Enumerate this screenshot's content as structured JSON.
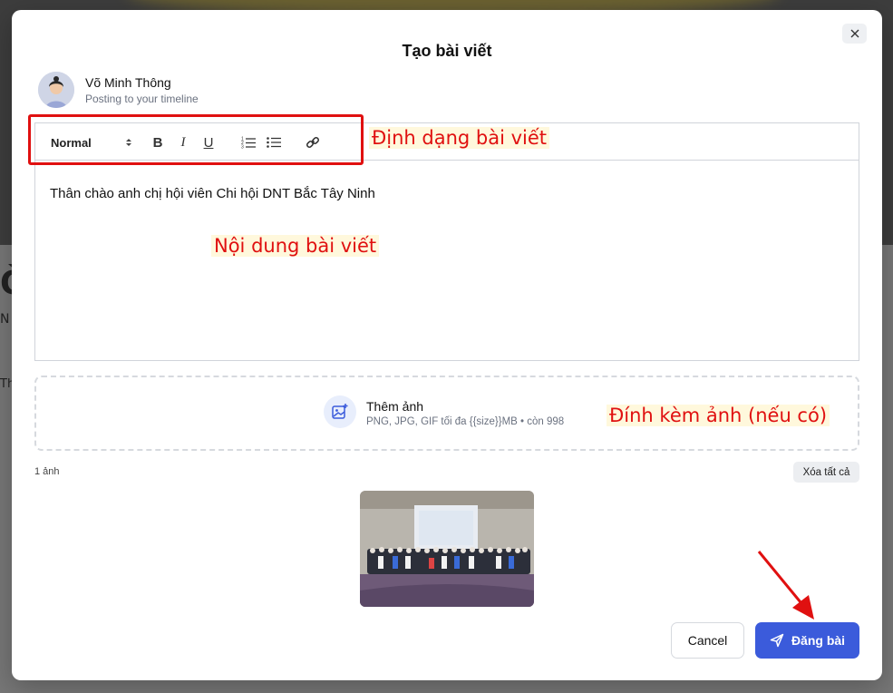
{
  "modal": {
    "title": "Tạo bài viết"
  },
  "user": {
    "name": "Võ Minh Thông",
    "subtitle": "Posting to your timeline"
  },
  "toolbar": {
    "format_value": "Normal",
    "bold": "B",
    "italic": "I",
    "underline": "U"
  },
  "editor": {
    "content": "Thân chào anh chị hội viên Chi hội DNT Bắc Tây Ninh"
  },
  "upload": {
    "title": "Thêm ảnh",
    "subtitle": "PNG, JPG, GIF tối đa {{size}}MB • còn 998"
  },
  "images": {
    "count_label": "1 ảnh",
    "clear_all": "Xóa tất cả"
  },
  "actions": {
    "cancel": "Cancel",
    "post": "Đăng bài"
  },
  "annotations": {
    "format": "Định dạng bài viết",
    "content": "Nội dung bài viết",
    "attach": "Đính kèm ảnh (nếu có)"
  },
  "colors": {
    "primary": "#3b5bdb",
    "annotation": "#e01010"
  }
}
